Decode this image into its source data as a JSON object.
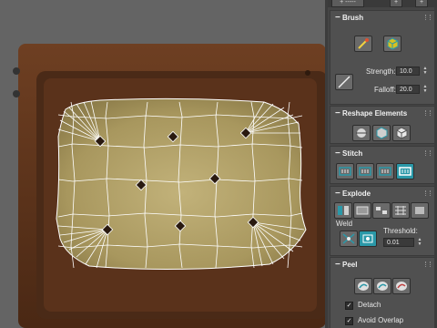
{
  "topbar": {
    "button_left_label": "+ -----",
    "button_mid_label": "+",
    "button_right_label": "+"
  },
  "brush": {
    "title": "Brush",
    "strength_label": "Strength:",
    "strength_value": "10.0",
    "falloff_label": "Falloff:",
    "falloff_value": "20.0",
    "icons": [
      "paint-brush-icon",
      "relax-cube-icon",
      "pen-line-icon"
    ]
  },
  "reshape": {
    "title": "Reshape Elements",
    "icons": [
      "straighten-icon",
      "relax-icon",
      "cube-icon"
    ]
  },
  "stitch": {
    "title": "Stitch",
    "icons": [
      "stitch-custom-icon",
      "stitch-source-icon",
      "stitch-average-icon",
      "stitch-target-icon"
    ]
  },
  "explode": {
    "title": "Explode",
    "weld_label": "Weld",
    "threshold_label": "Threshold:",
    "threshold_value": "0.01",
    "icons": [
      "explode-select-icon",
      "explode-smoothing-icon",
      "explode-material-icon",
      "explode-grid-icon",
      "explode-flat-icon"
    ]
  },
  "peel": {
    "title": "Peel",
    "detach_label": "Detach",
    "detach_checked": true,
    "avoid_overlap_label": "Avoid Overlap",
    "avoid_overlap_checked": true
  },
  "colors": {
    "active_button": "#2a98a8",
    "panel_bg": "#505050",
    "uv_wire": "#ffffff"
  }
}
